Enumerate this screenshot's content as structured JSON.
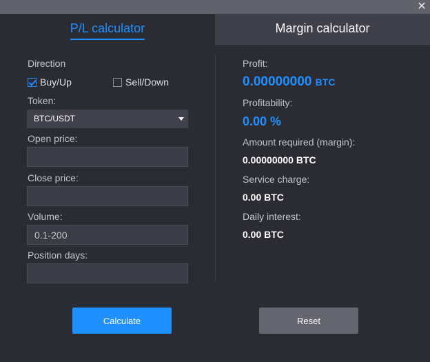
{
  "window": {
    "close_icon": "close-icon"
  },
  "tabs": [
    {
      "label": "P/L calculator",
      "active": true
    },
    {
      "label": "Margin calculator",
      "active": false
    }
  ],
  "form": {
    "direction_label": "Direction",
    "direction_options": [
      {
        "label": "Buy/Up",
        "checked": true
      },
      {
        "label": "Sell/Down",
        "checked": false
      }
    ],
    "token_label": "Token:",
    "token_value": "BTC/USDT",
    "open_price_label": "Open price:",
    "open_price_value": "",
    "close_price_label": "Close price:",
    "close_price_value": "",
    "volume_label": "Volume:",
    "volume_placeholder": "0.1-200",
    "position_days_label": "Position days:",
    "position_days_value": ""
  },
  "results": {
    "profit_label": "Profit:",
    "profit_value": "0.00000000",
    "profit_unit": "BTC",
    "profitability_label": "Profitability:",
    "profitability_value": "0.00 %",
    "amount_label": "Amount required (margin):",
    "amount_value": "0.00000000 BTC",
    "service_label": "Service charge:",
    "service_value": "0.00 BTC",
    "interest_label": "Daily interest:",
    "interest_value": "0.00 BTC"
  },
  "buttons": {
    "calculate": "Calculate",
    "reset": "Reset"
  },
  "colors": {
    "accent": "#1e90ff",
    "background": "#2b2c33",
    "tab_inactive": "#3f404a"
  }
}
